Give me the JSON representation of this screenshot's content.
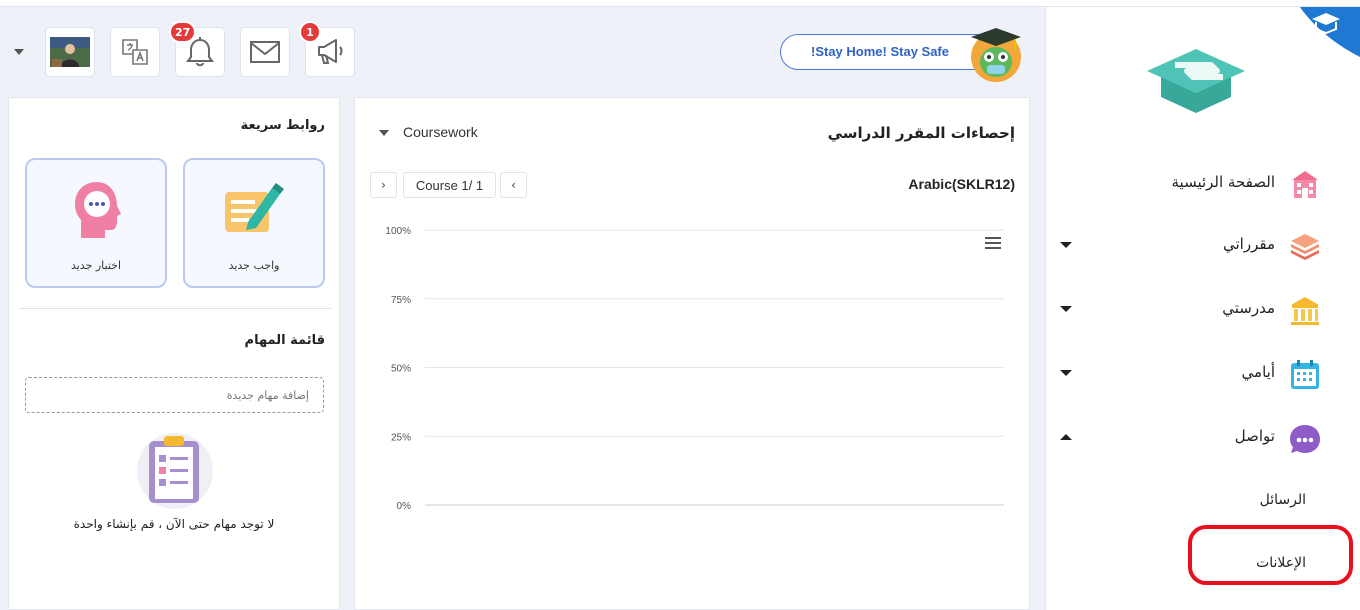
{
  "banner": {
    "text": "!Stay Home! Stay Safe"
  },
  "topbar": {
    "notifications_count": "27",
    "announcements_count": "1",
    "icons": [
      "avatar-photo",
      "translate-icon",
      "bell-icon",
      "envelope-icon",
      "megaphone-icon"
    ]
  },
  "sidebar": {
    "items": [
      {
        "label": "الصفحة الرئيسية",
        "icon": "home-icon"
      },
      {
        "label": "مقرراتي",
        "icon": "books-icon"
      },
      {
        "label": "مدرستي",
        "icon": "school-icon"
      },
      {
        "label": "أيامي",
        "icon": "calendar-icon"
      },
      {
        "label": "تواصل",
        "icon": "chat-icon"
      }
    ],
    "sub_items": [
      "الرسائل",
      "الإعلانات"
    ]
  },
  "quick_links": {
    "title": "روابط سريعة",
    "cards": [
      {
        "label": "واجب جديد",
        "icon": "assignment-icon"
      },
      {
        "label": "اختبار جديد",
        "icon": "quiz-icon"
      }
    ]
  },
  "tasks": {
    "title": "قائمة المهام",
    "input_placeholder": "إضافة مهام جديدة",
    "empty_text": "لا توجد مهام حتى الآن ، قم بإنشاء واحدة"
  },
  "stats": {
    "title": "إحصاءات المقرر الدراسي",
    "selector_value": "Coursework",
    "course_name": "Arabic(SKLR12)",
    "pager_label": "Course 1/ 1",
    "prev_symbol": "‹",
    "next_symbol": "›"
  },
  "chart_data": {
    "type": "bar",
    "categories": [],
    "values": [],
    "ylim": [
      0,
      100
    ],
    "yticks": [
      "100%",
      "75%",
      "50%",
      "25%",
      "0%"
    ],
    "grid": true
  }
}
